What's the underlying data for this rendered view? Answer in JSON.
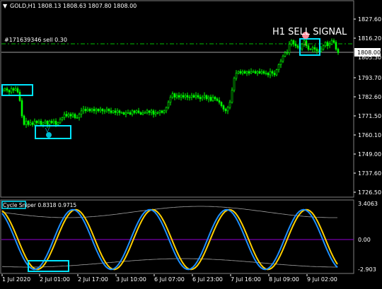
{
  "symbol_header": {
    "collapse_arrow": "▼",
    "text": "GOLD,H1  1808.13 1808.63 1807.80 1808.00"
  },
  "order_line_label": "#171639346 sell 0.30",
  "signal_label": "H1 SELL SIGNAL",
  "current_price": "1808.00",
  "price_axis": [
    "1827.60",
    "1816.20",
    "1805.30",
    "1793.70",
    "1782.60",
    "1771.50",
    "1760.10",
    "1749.00",
    "1737.60",
    "1726.50"
  ],
  "indicator": {
    "title": "Cycle Sniper 0.8318 0.9715",
    "axis": [
      "3.4063",
      "0.00",
      "-2.903"
    ]
  },
  "time_axis": [
    "1 Jul 2020",
    "2 Jul 01:00",
    "2 Jul 17:00",
    "3 Jul 10:00",
    "6 Jul 07:00",
    "6 Jul 23:00",
    "7 Jul 16:00",
    "8 Jul 09:00",
    "9 Jul 02:00"
  ],
  "colors": {
    "background": "#000000",
    "candles": "#00ff00",
    "highlight_box": "#00e5ff",
    "order_line": "#00c000",
    "cycle_blue": "#1e90ff",
    "cycle_gold": "#ffd000",
    "band_line": "#a0a0a0",
    "zero_line": "#9400d3",
    "sell_marker": "#ff8c9c",
    "buy_marker": "#00bcd4"
  },
  "chart_data": {
    "type": "candlestick",
    "instrument": "GOLD,H1",
    "ohlc_last": {
      "open": 1808.13,
      "high": 1808.63,
      "low": 1807.8,
      "close": 1808.0
    },
    "ylim": [
      1726.5,
      1827.6
    ],
    "price_ticks": [
      1827.6,
      1816.2,
      1805.3,
      1793.7,
      1782.6,
      1771.5,
      1760.1,
      1749.0,
      1737.6,
      1726.5
    ],
    "close_path": [
      [
        0,
        1786
      ],
      [
        3,
        1787
      ],
      [
        6,
        1786
      ],
      [
        9,
        1785
      ],
      [
        12,
        1787
      ],
      [
        15,
        1786
      ],
      [
        18,
        1787
      ],
      [
        21,
        1785
      ],
      [
        24,
        1780
      ],
      [
        27,
        1771
      ],
      [
        30,
        1766
      ],
      [
        33,
        1768
      ],
      [
        36,
        1766
      ],
      [
        39,
        1767
      ],
      [
        42,
        1766
      ],
      [
        45,
        1768
      ],
      [
        48,
        1767
      ],
      [
        51,
        1768
      ],
      [
        54,
        1766
      ],
      [
        57,
        1767
      ],
      [
        60,
        1768
      ],
      [
        63,
        1766
      ],
      [
        66,
        1768
      ],
      [
        69,
        1767
      ],
      [
        72,
        1768
      ],
      [
        75,
        1766
      ],
      [
        78,
        1767
      ],
      [
        81,
        1769
      ],
      [
        84,
        1770
      ],
      [
        87,
        1772
      ],
      [
        90,
        1771
      ],
      [
        93,
        1772
      ],
      [
        96,
        1771
      ],
      [
        99,
        1772
      ],
      [
        102,
        1770
      ],
      [
        105,
        1770
      ],
      [
        108,
        1772
      ],
      [
        111,
        1774
      ],
      [
        114,
        1775
      ],
      [
        117,
        1774
      ],
      [
        120,
        1775
      ],
      [
        123,
        1774
      ],
      [
        126,
        1775
      ],
      [
        129,
        1774
      ],
      [
        132,
        1775
      ],
      [
        135,
        1774
      ],
      [
        138,
        1775
      ],
      [
        141,
        1774
      ],
      [
        144,
        1774
      ],
      [
        147,
        1775
      ],
      [
        150,
        1774
      ],
      [
        153,
        1773
      ],
      [
        156,
        1774
      ],
      [
        159,
        1773
      ],
      [
        162,
        1774
      ],
      [
        165,
        1773
      ],
      [
        168,
        1773
      ],
      [
        171,
        1772
      ],
      [
        174,
        1773
      ],
      [
        177,
        1773
      ],
      [
        180,
        1772
      ],
      [
        183,
        1774
      ],
      [
        186,
        1773
      ],
      [
        189,
        1774
      ],
      [
        192,
        1773
      ],
      [
        195,
        1772
      ],
      [
        198,
        1773
      ],
      [
        201,
        1773
      ],
      [
        204,
        1774
      ],
      [
        207,
        1773
      ],
      [
        210,
        1774
      ],
      [
        213,
        1772
      ],
      [
        216,
        1773
      ],
      [
        219,
        1773
      ],
      [
        222,
        1774
      ],
      [
        225,
        1773
      ],
      [
        228,
        1774
      ],
      [
        231,
        1776
      ],
      [
        234,
        1779
      ],
      [
        237,
        1782
      ],
      [
        240,
        1784
      ],
      [
        243,
        1782
      ],
      [
        246,
        1783
      ],
      [
        249,
        1782
      ],
      [
        252,
        1783
      ],
      [
        255,
        1782
      ],
      [
        258,
        1783
      ],
      [
        261,
        1782
      ],
      [
        264,
        1782
      ],
      [
        267,
        1783
      ],
      [
        270,
        1782
      ],
      [
        273,
        1783
      ],
      [
        276,
        1782
      ],
      [
        279,
        1781
      ],
      [
        282,
        1782
      ],
      [
        285,
        1783
      ],
      [
        288,
        1781
      ],
      [
        291,
        1782
      ],
      [
        294,
        1780
      ],
      [
        297,
        1782
      ],
      [
        300,
        1781
      ],
      [
        303,
        1780
      ],
      [
        306,
        1779
      ],
      [
        309,
        1777
      ],
      [
        312,
        1775
      ],
      [
        315,
        1774
      ],
      [
        318,
        1776
      ],
      [
        321,
        1779
      ],
      [
        324,
        1786
      ],
      [
        327,
        1793
      ],
      [
        330,
        1796
      ],
      [
        333,
        1797
      ],
      [
        336,
        1796
      ],
      [
        339,
        1797
      ],
      [
        342,
        1796
      ],
      [
        345,
        1797
      ],
      [
        348,
        1796
      ],
      [
        351,
        1797
      ],
      [
        354,
        1797
      ],
      [
        357,
        1796
      ],
      [
        360,
        1797
      ],
      [
        363,
        1796
      ],
      [
        366,
        1797
      ],
      [
        369,
        1796
      ],
      [
        372,
        1796
      ],
      [
        375,
        1795
      ],
      [
        378,
        1797
      ],
      [
        381,
        1796
      ],
      [
        384,
        1795
      ],
      [
        387,
        1798
      ],
      [
        390,
        1801
      ],
      [
        393,
        1803
      ],
      [
        396,
        1806
      ],
      [
        399,
        1808
      ],
      [
        402,
        1808
      ],
      [
        405,
        1813
      ],
      [
        408,
        1815
      ],
      [
        411,
        1813
      ],
      [
        414,
        1812
      ],
      [
        417,
        1811
      ],
      [
        420,
        1810
      ],
      [
        423,
        1813
      ],
      [
        426,
        1815
      ],
      [
        429,
        1812
      ],
      [
        432,
        1810
      ],
      [
        435,
        1810
      ],
      [
        438,
        1811
      ],
      [
        441,
        1810
      ],
      [
        444,
        1809
      ],
      [
        447,
        1809
      ],
      [
        450,
        1810
      ],
      [
        453,
        1812
      ],
      [
        456,
        1814
      ],
      [
        459,
        1812
      ],
      [
        462,
        1813
      ],
      [
        465,
        1815
      ],
      [
        468,
        1814
      ],
      [
        471,
        1810
      ],
      [
        474,
        1808
      ]
    ],
    "indicator_name": "Cycle Sniper",
    "indicator_values": [
      0.8318,
      0.9715
    ],
    "indicator_ylim": [
      -2.903,
      3.4063
    ]
  }
}
